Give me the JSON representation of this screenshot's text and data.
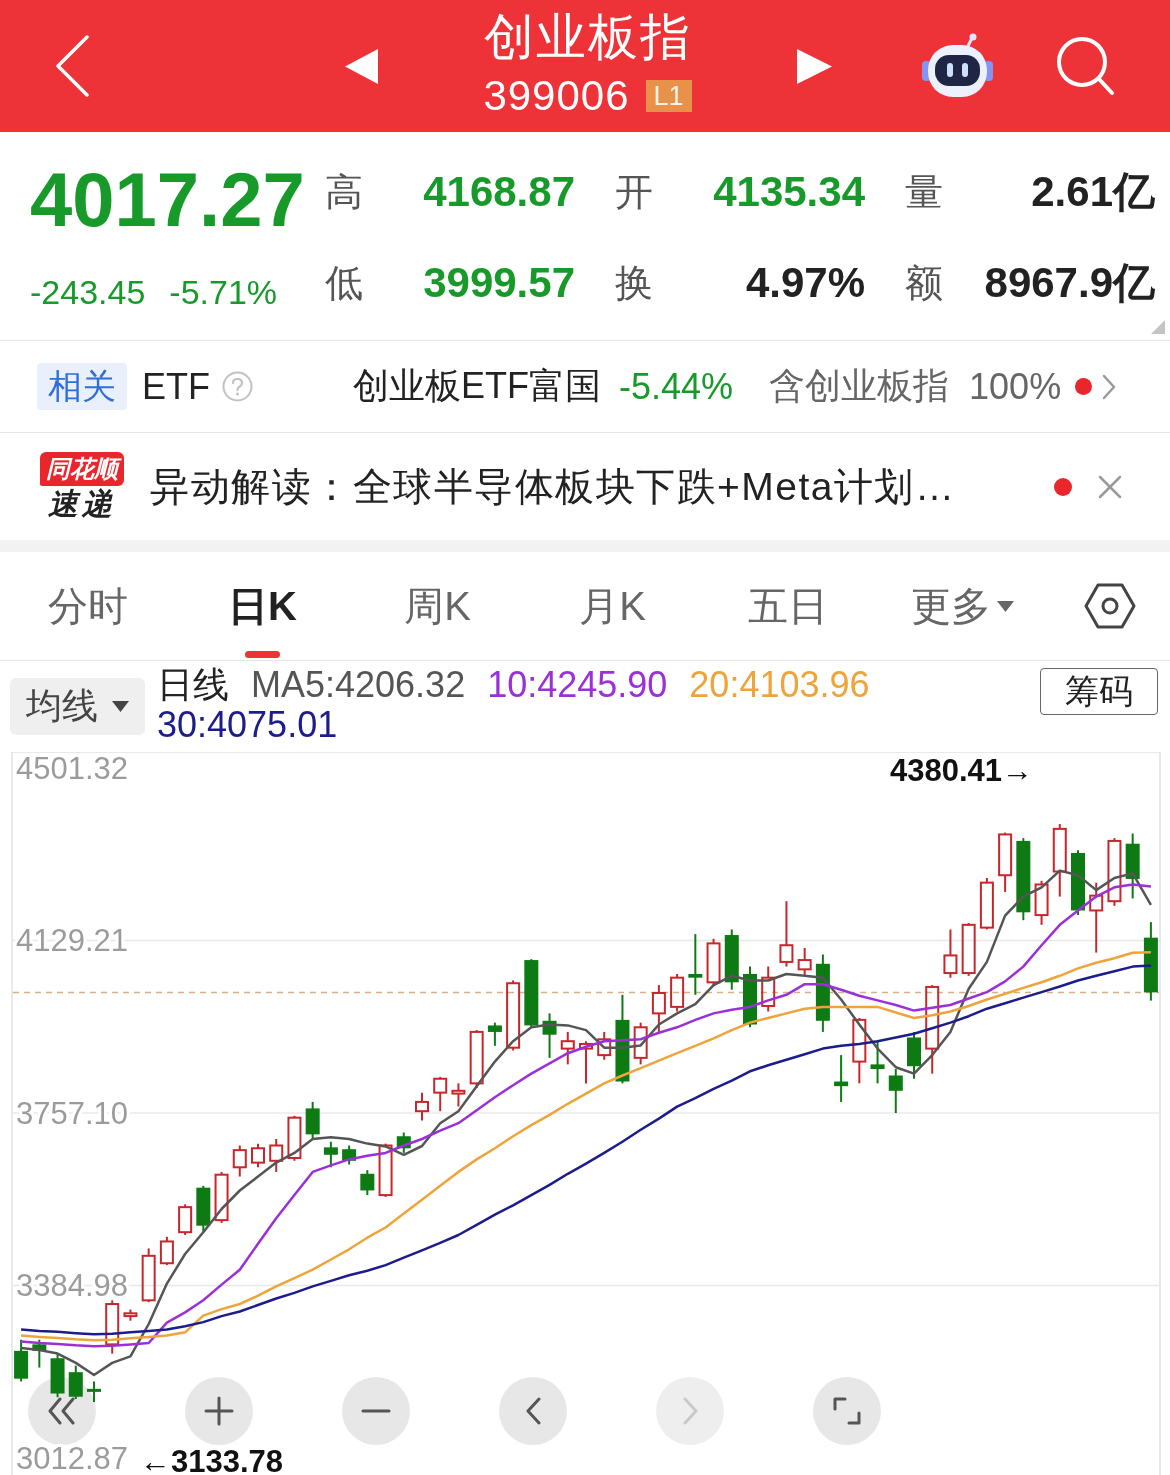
{
  "header": {
    "title": "创业板指",
    "code": "399006",
    "level_badge": "L1"
  },
  "quote": {
    "price": "4017.27",
    "change": "-243.45",
    "change_percent": "-5.71%",
    "color": "#179a2a",
    "stats": [
      {
        "label": "高",
        "value": "4168.87",
        "color": "#179a2a"
      },
      {
        "label": "开",
        "value": "4135.34",
        "color": "#179a2a"
      },
      {
        "label": "量",
        "value": "2.61亿",
        "color": "#222222"
      },
      {
        "label": "低",
        "value": "3999.57",
        "color": "#179a2a"
      },
      {
        "label": "换",
        "value": "4.97%",
        "color": "#222222"
      },
      {
        "label": "额",
        "value": "8967.9亿",
        "color": "#222222"
      }
    ]
  },
  "related_etf": {
    "tag": "相关",
    "label": "ETF",
    "fund_name": "创业板ETF富国",
    "fund_change": {
      "text": "-5.44%",
      "color": "#179a2a"
    },
    "holding_label": "含创业板指",
    "holding_share": "100%",
    "unread": true
  },
  "news_flash": {
    "logo_top": "同花顺",
    "logo_bottom": "速递",
    "headline": "异动解读：全球半导体板块下跌+Meta计划…",
    "unread": true
  },
  "chart_tabs": [
    {
      "label": "分时",
      "selected": false,
      "kind": "tab"
    },
    {
      "label": "日K",
      "selected": true,
      "kind": "tab"
    },
    {
      "label": "周K",
      "selected": false,
      "kind": "tab"
    },
    {
      "label": "月K",
      "selected": false,
      "kind": "tab"
    },
    {
      "label": "五日",
      "selected": false,
      "kind": "tab"
    },
    {
      "label": "更多",
      "selected": false,
      "kind": "menu"
    }
  ],
  "indicator_bar": {
    "selector": "均线",
    "period": "日线",
    "ma_values": [
      {
        "text": "MA5:4206.32",
        "color": "#555555"
      },
      {
        "text": "10:4245.90",
        "color": "#9b30d9"
      },
      {
        "text": "20:4103.96",
        "color": "#eea43a"
      },
      {
        "text": "30:4075.01",
        "color": "#1c1c8c"
      }
    ],
    "chips_button": "筹码"
  },
  "kline_chart": {
    "chart_data": {
      "type": "candlestick",
      "ylim": [
        2896.38,
        4535.84
      ],
      "yticks": [
        4501.32,
        4129.21,
        {
          "value": 3757.1,
          "label": "3757.10"
        },
        3384.98,
        3012.87
      ],
      "grid": true,
      "ref_lines": [
        {
          "axis": "y",
          "value": 4017.27
        }
      ],
      "ohlc": [
        [
          3244,
          3268,
          3178,
          3184
        ],
        [
          3258,
          3268,
          3208,
          3244
        ],
        [
          3228,
          3238,
          3144,
          3152
        ],
        [
          3198,
          3212,
          3140,
          3145
        ],
        [
          3162,
          3178,
          3133.78,
          3156
        ],
        [
          3258,
          3353,
          3238,
          3345
        ],
        [
          3319,
          3333,
          3309,
          3325
        ],
        [
          3353,
          3465,
          3349,
          3449
        ],
        [
          3433,
          3490,
          3429,
          3480
        ],
        [
          3500,
          3560,
          3494,
          3554
        ],
        [
          3596,
          3600,
          3500,
          3514
        ],
        [
          3526,
          3630,
          3520,
          3624
        ],
        [
          3640,
          3687,
          3620,
          3677
        ],
        [
          3650,
          3691,
          3640,
          3681
        ],
        [
          3654,
          3701,
          3630,
          3687
        ],
        [
          3660,
          3751,
          3654,
          3747
        ],
        [
          3767,
          3781,
          3701,
          3711
        ],
        [
          3683,
          3695,
          3640,
          3667
        ],
        [
          3679,
          3687,
          3646,
          3654
        ],
        [
          3626,
          3634,
          3580,
          3590
        ],
        [
          3580,
          3691,
          3576,
          3687
        ],
        [
          3707,
          3715,
          3671,
          3681
        ],
        [
          3761,
          3801,
          3741,
          3781
        ],
        [
          3801,
          3835,
          3761,
          3831
        ],
        [
          3799,
          3821,
          3771,
          3805
        ],
        [
          3821,
          3936,
          3811,
          3932
        ],
        [
          3946,
          3952,
          3902,
          3932
        ],
        [
          3898,
          4043,
          3892,
          4037
        ],
        [
          4087,
          4089,
          3942,
          3946
        ],
        [
          3956,
          3972,
          3876,
          3926
        ],
        [
          3896,
          3932,
          3862,
          3912
        ],
        [
          3896,
          3912,
          3821,
          3906
        ],
        [
          3882,
          3932,
          3872,
          3916
        ],
        [
          3958,
          4012,
          3821,
          3825
        ],
        [
          3876,
          3952,
          3862,
          3942
        ],
        [
          3972,
          4033,
          3932,
          4016
        ],
        [
          3986,
          4057,
          3976,
          4049
        ],
        [
          4057,
          4143,
          4012,
          4049
        ],
        [
          4039,
          4133,
          4033,
          4123
        ],
        [
          4141,
          4153,
          4023,
          4039
        ],
        [
          4057,
          4073,
          3942,
          3948
        ],
        [
          3988,
          4073,
          3976,
          4049
        ],
        [
          4083,
          4214,
          4073,
          4119
        ],
        [
          4067,
          4113,
          4053,
          4087
        ],
        [
          4079,
          4099,
          3932,
          3956
        ],
        [
          3825,
          3882,
          3781,
          3815
        ],
        [
          3868,
          3962,
          3821,
          3958
        ],
        [
          3862,
          3912,
          3821,
          3852
        ],
        [
          3838,
          3852,
          3757,
          3805
        ],
        [
          3920,
          3932,
          3831,
          3858
        ],
        [
          3896,
          4033,
          3842,
          4029
        ],
        [
          4059,
          4153,
          4049,
          4097
        ],
        [
          4059,
          4167,
          4053,
          4163
        ],
        [
          4157,
          4264,
          4153,
          4254
        ],
        [
          4270,
          4362,
          4234,
          4358
        ],
        [
          4344,
          4350,
          4173,
          4190
        ],
        [
          4184,
          4258,
          4163,
          4250
        ],
        [
          4278,
          4380.41,
          4224,
          4370
        ],
        [
          4318,
          4324,
          4184,
          4194
        ],
        [
          4194,
          4254,
          4103,
          4226
        ],
        [
          4214,
          4350,
          4204,
          4344
        ],
        [
          4338,
          4360,
          4220,
          4262
        ],
        [
          4135.34,
          4168.87,
          3999.57,
          4017.27
        ]
      ],
      "series": [
        {
          "type": "line",
          "color": "#555555",
          "values": [
            3250,
            3246,
            3238,
            3218,
            3192,
            3218,
            3232,
            3302,
            3389,
            3453,
            3500,
            3550,
            3590,
            3620,
            3650,
            3671,
            3701,
            3705,
            3701,
            3691,
            3685,
            3667,
            3686,
            3735,
            3761,
            3815,
            3868,
            3912,
            3942,
            3948,
            3946,
            3936,
            3898,
            3898,
            3903,
            3948,
            3972,
            3992,
            4033,
            4053,
            4043,
            4043,
            4057,
            4053,
            4049,
            4002,
            3948,
            3896,
            3856,
            3842,
            3882,
            3932,
            4025,
            4083,
            4183,
            4224,
            4244,
            4280,
            4270,
            4238,
            4264,
            4274,
            4206
          ]
        },
        {
          "type": "line",
          "color": "#9b30d9",
          "values": [
            3264,
            3261,
            3259,
            3256,
            3254,
            3255,
            3258,
            3261,
            3305,
            3327,
            3353,
            3387,
            3419,
            3475,
            3530,
            3580,
            3630,
            3644,
            3657,
            3665,
            3671,
            3687,
            3701,
            3719,
            3735,
            3763,
            3791,
            3817,
            3842,
            3864,
            3886,
            3900,
            3912,
            3914,
            3916,
            3930,
            3942,
            3958,
            3972,
            3980,
            3986,
            4000,
            4012,
            4035,
            4035,
            4023,
            4010,
            4000,
            3990,
            3978,
            3984,
            3990,
            4004,
            4018,
            4041,
            4073,
            4119,
            4163,
            4194,
            4224,
            4244,
            4250,
            4246
          ]
        },
        {
          "type": "line",
          "color": "#eea43a",
          "values": [
            3277,
            3274,
            3272,
            3269,
            3267,
            3268,
            3271,
            3274,
            3277,
            3284,
            3320,
            3334,
            3345,
            3363,
            3383,
            3401,
            3419,
            3441,
            3463,
            3488,
            3510,
            3540,
            3570,
            3600,
            3630,
            3657,
            3681,
            3707,
            3731,
            3753,
            3777,
            3799,
            3821,
            3838,
            3854,
            3870,
            3886,
            3902,
            3918,
            3936,
            3952,
            3962,
            3972,
            3982,
            3986,
            3986,
            3986,
            3986,
            3974,
            3962,
            3968,
            3976,
            3988,
            4002,
            4014,
            4027,
            4039,
            4053,
            4069,
            4081,
            4091,
            4103,
            4104
          ]
        },
        {
          "type": "line",
          "color": "#1c1c8c",
          "values": [
            3290,
            3287,
            3285,
            3282,
            3280,
            3281,
            3284,
            3287,
            3290,
            3297,
            3306,
            3319,
            3329,
            3343,
            3357,
            3369,
            3383,
            3395,
            3407,
            3417,
            3429,
            3445,
            3461,
            3477,
            3494,
            3516,
            3538,
            3558,
            3580,
            3602,
            3626,
            3648,
            3671,
            3695,
            3721,
            3745,
            3771,
            3789,
            3809,
            3827,
            3847,
            3860,
            3872,
            3884,
            3896,
            3902,
            3906,
            3912,
            3920,
            3928,
            3940,
            3952,
            3966,
            3982,
            3994,
            4006,
            4018,
            4030,
            4043,
            4053,
            4063,
            4073,
            4075
          ]
        }
      ]
    },
    "high_marker": "4380.41→",
    "low_marker": "←3133.78",
    "controls": [
      {
        "kind": "rewind",
        "disabled": false
      },
      {
        "kind": "zoom-in",
        "disabled": false
      },
      {
        "kind": "zoom-out",
        "disabled": false
      },
      {
        "kind": "back",
        "disabled": false
      },
      {
        "kind": "forward",
        "disabled": true
      },
      {
        "kind": "fullscreen",
        "disabled": false
      }
    ]
  }
}
